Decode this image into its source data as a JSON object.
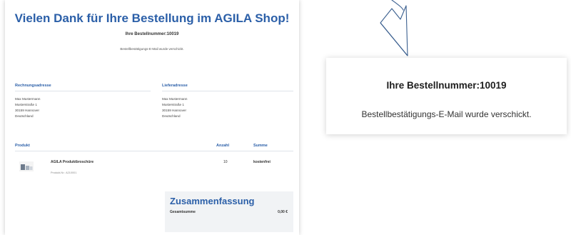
{
  "confirmation": {
    "headline": "Vielen Dank für Ihre Bestellung im AGILA Shop!",
    "order_number_line": "Ihre Bestellnummer:10019",
    "mail_sent": "Bestellbestätigungs-E-Mail wurde verschickt."
  },
  "addresses": {
    "billing": {
      "heading": "Rechnungsadresse",
      "lines": [
        "Max Mustermann",
        "Musterstraße 1",
        "30159 Hannover",
        "Deutschland"
      ]
    },
    "shipping": {
      "heading": "Lieferadresse",
      "lines": [
        "Max Mustermann",
        "Musterstraße 1",
        "30159 Hannover",
        "Deutschland"
      ]
    }
  },
  "products": {
    "columns": [
      "Produkt",
      "Anzahl",
      "Summe"
    ],
    "items": [
      {
        "name": "AGILA Produktbroschüre",
        "sku": "Produkt-Nr.: A210001",
        "quantity": "10",
        "sum": "kostenfrei"
      }
    ]
  },
  "summary": {
    "title": "Zusammenfassung",
    "total_label": "Gesamtsumme",
    "total_value": "0,00 €"
  },
  "zoom": {
    "order_number_line": "Ihre Bestellnummer:10019",
    "mail_sent": "Bestellbestätigungs-E-Mail wurde verschickt."
  },
  "colors": {
    "brand_blue": "#2b5fa8",
    "arrow_blue": "#3a5f8f"
  },
  "icons": [
    "hand-drawn-arrow-icon",
    "product-thumbnail-icon"
  ]
}
